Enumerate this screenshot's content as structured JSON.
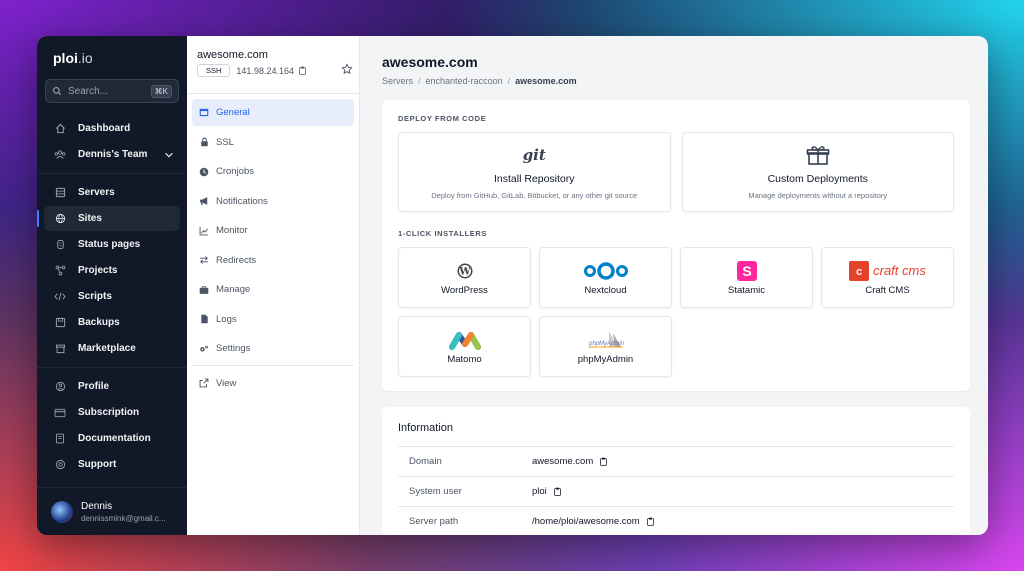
{
  "sidebar": {
    "logo_main": "ploi",
    "logo_suffix": ".io",
    "search_placeholder": "Search...",
    "search_shortcut": "⌘K",
    "items": [
      {
        "label": "Dashboard",
        "icon": "home-icon"
      },
      {
        "label": "Dennis's Team",
        "icon": "team-icon"
      },
      {
        "label": "Servers",
        "icon": "server-icon"
      },
      {
        "label": "Sites",
        "icon": "globe-icon"
      },
      {
        "label": "Status pages",
        "icon": "status-icon"
      },
      {
        "label": "Projects",
        "icon": "projects-icon"
      },
      {
        "label": "Scripts",
        "icon": "code-icon"
      },
      {
        "label": "Backups",
        "icon": "backup-icon"
      },
      {
        "label": "Marketplace",
        "icon": "store-icon"
      },
      {
        "label": "Profile",
        "icon": "user-icon"
      },
      {
        "label": "Subscription",
        "icon": "card-icon"
      },
      {
        "label": "Documentation",
        "icon": "book-icon"
      },
      {
        "label": "Support",
        "icon": "support-icon"
      }
    ],
    "user": {
      "name": "Dennis",
      "email": "dennissmink@gmail.c..."
    }
  },
  "site": {
    "name": "awesome.com",
    "ssh_label": "SSH",
    "ip": "141.98.24.164"
  },
  "subnav": [
    {
      "label": "General",
      "icon": "browser-icon"
    },
    {
      "label": "SSL",
      "icon": "lock-icon"
    },
    {
      "label": "Cronjobs",
      "icon": "clock-icon"
    },
    {
      "label": "Notifications",
      "icon": "megaphone-icon"
    },
    {
      "label": "Monitor",
      "icon": "chart-icon"
    },
    {
      "label": "Redirects",
      "icon": "arrows-icon"
    },
    {
      "label": "Manage",
      "icon": "briefcase-icon"
    },
    {
      "label": "Logs",
      "icon": "document-icon"
    },
    {
      "label": "Settings",
      "icon": "cog-icon"
    },
    {
      "label": "View",
      "icon": "external-link-icon"
    }
  ],
  "main": {
    "title": "awesome.com",
    "breadcrumbs": [
      "Servers",
      "enchanted-raccoon",
      "awesome.com"
    ],
    "deploy": {
      "section_label": "DEPLOY FROM CODE",
      "options": [
        {
          "icon_text": "git",
          "title": "Install Repository",
          "desc": "Deploy from GitHub, GitLab, Bitbucket, or any other git source"
        },
        {
          "title": "Custom Deployments",
          "desc": "Manage deployments without a repository"
        }
      ]
    },
    "installers": {
      "section_label": "1-CLICK INSTALLERS",
      "items": [
        "WordPress",
        "Nextcloud",
        "Statamic",
        "Craft CMS",
        "Matomo",
        "phpMyAdmin"
      ],
      "craft_logo_text": "craft cms",
      "statamic_logo_text": "S",
      "craft_logo_letter": "c",
      "wordpress_logo_text": "W",
      "php_logo_text": "phpMyAdmin"
    },
    "information": {
      "title": "Information",
      "rows": [
        {
          "key": "Domain",
          "value": "awesome.com"
        },
        {
          "key": "System user",
          "value": "ploi"
        },
        {
          "key": "Server path",
          "value": "/home/ploi/awesome.com"
        }
      ]
    }
  },
  "colors": {
    "accent": "#2563eb",
    "sidebar_bg": "#111827",
    "nextcloud": "#0082c9",
    "statamic": "#ff269e",
    "craft": "#e5422b"
  }
}
